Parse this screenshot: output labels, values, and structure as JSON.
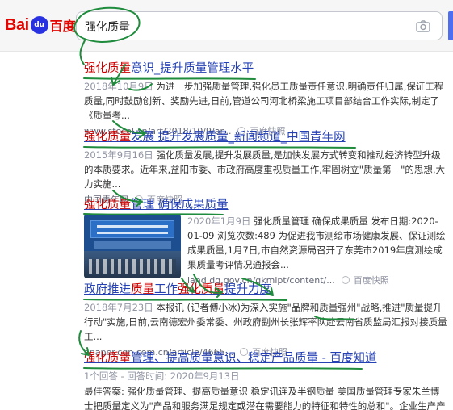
{
  "header": {
    "logo_bai": "Bai",
    "logo_du": "du",
    "logo_cn": "百度",
    "search_value": "强化质量"
  },
  "results": [
    {
      "title_parts": [
        "强化质量",
        "意识_提升质量管理水平"
      ],
      "date": "2018年10月9日",
      "abstract": " 为进一步加强质量管理,强化员工质量责任意识,明确责任归属,保证工程质量,同时鼓励创新、奖励先进,日前,管道公司河北桥梁施工项目部结合工作实际,制定了《质量考...",
      "url": "www.stocol.cn/art/2018/10/9/ar...",
      "snapshot": "百度快照"
    },
    {
      "title_parts": [
        "强化质量",
        "发展 提升发展质量_新闻频道_中国青年网"
      ],
      "date": "2015年9月16日",
      "abstract": " 强化质量发展,提升发展质量,是加快发展方式转变和推动经济转型升级的本质要求。近年来,益阳市委、市政府高度重视质量工作,牢固树立\"质量第一\"的思想,大力实施...",
      "url": "中国青年网",
      "snapshot": "百度快照"
    },
    {
      "title_parts": [
        "强化质量",
        "管理 确保成果质量"
      ],
      "date": "2020年1月9日",
      "abstract": " 强化质量管理 确保成果质量 发布日期:2020-01-09 浏览次数:489 为促进我市测绘市场健康发展、保证测绘成果质量,1月7日,市自然资源局召开了东莞市2019年度测绘成果质量考评情况通报会...",
      "url": "land.dg.gov.cn/gkmlpt/content/...",
      "snapshot": "百度快照"
    },
    {
      "title_parts": [
        "政府推进",
        "质量",
        "工作",
        "强化质量",
        "提升力度"
      ],
      "date": "2018年7月23日",
      "abstract": " 本报讯 (记者傅小冰)为深入实施\"品牌和质量强州\"战略,推进\"质量提升行动\"实施,日前,云南德宏州委常委、州政府副州长张辉率队赴云南省质监局汇报对接质量工...",
      "url": "epaper.cqn.com.cn/article/4665...",
      "snapshot": "百度快照"
    },
    {
      "title_parts": [
        "强化质量",
        "管理、提高质量意识、稳定产品质量 - 百度知道"
      ],
      "meta": "1个回答 - 回答时间: 2020年9月13日",
      "abstract": "最佳答案: 强化质量管理、提高质量意识 稳定讯连及半钢质量 美国质量管理专家朱兰博士把质量定义为\"产品和服务满足规定或潜在需要能力的特征和特性的总和\"。企业生产产品的..."
    }
  ],
  "colors": {
    "link": "#2440b3",
    "highlight": "#c00000",
    "annotation": "#1e8c3c"
  },
  "icons": {
    "camera": "camera-icon",
    "snapshot": "snapshot-circle-icon"
  }
}
